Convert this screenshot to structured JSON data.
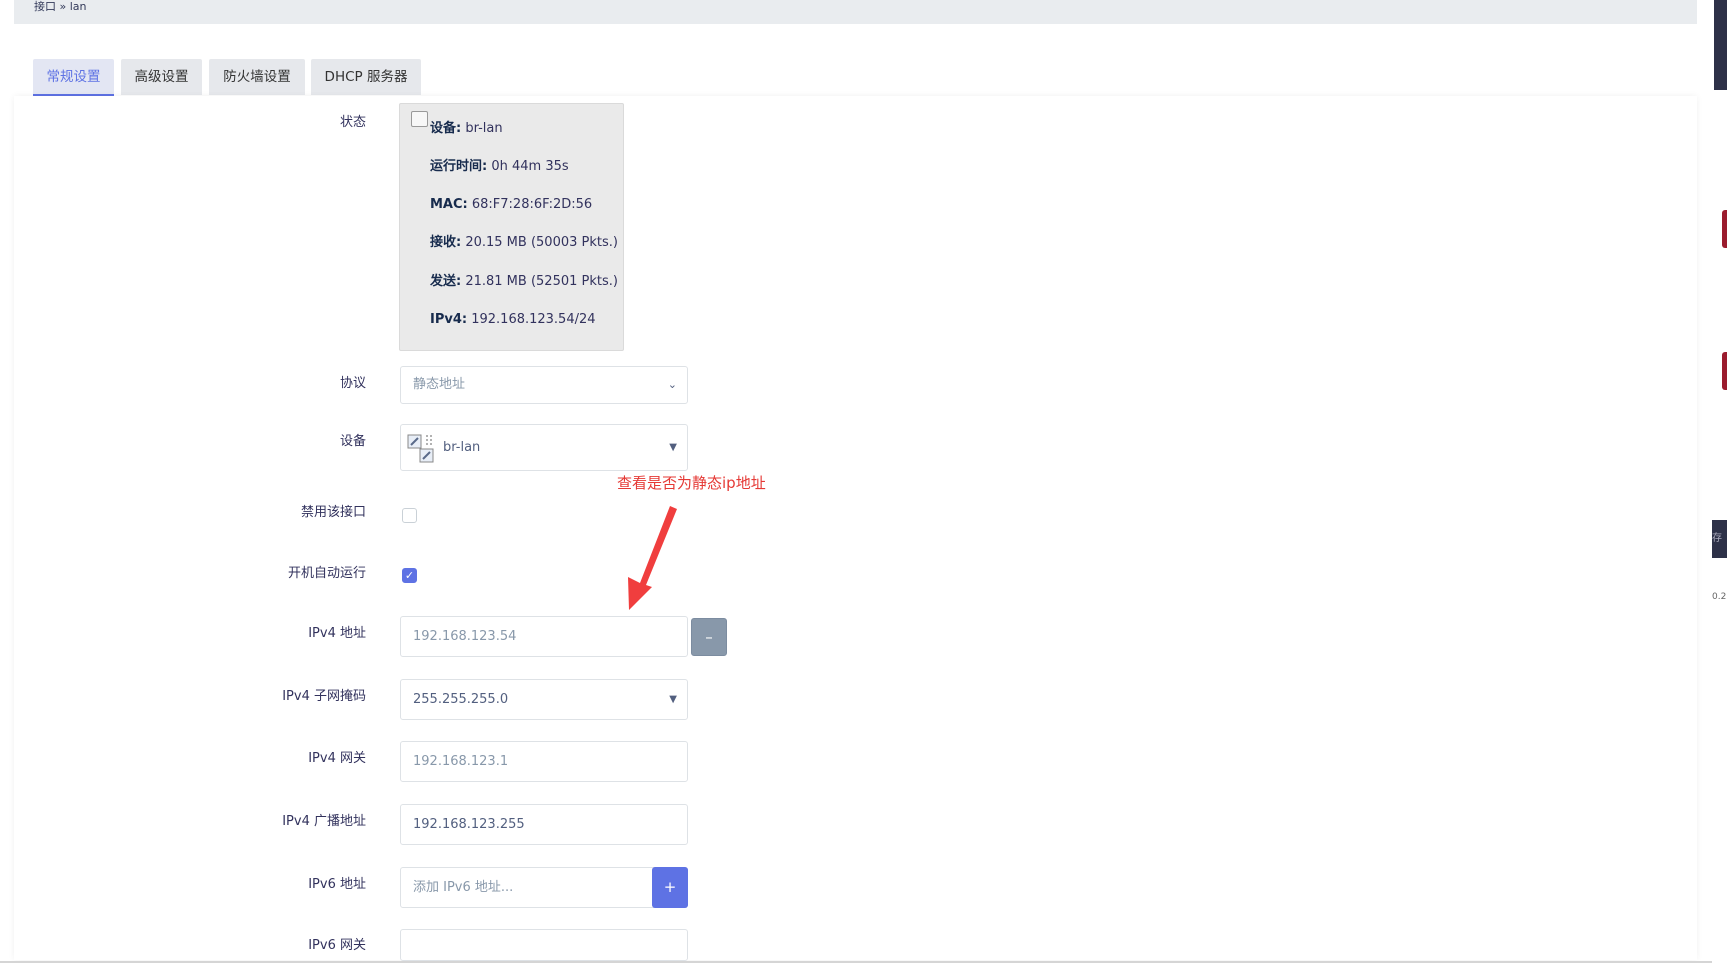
{
  "breadcrumb": "接口 » lan",
  "tabs": [
    {
      "label": "常规设置",
      "active": true
    },
    {
      "label": "高级设置"
    },
    {
      "label": "防火墙设置"
    },
    {
      "label": "DHCP 服务器"
    }
  ],
  "status": {
    "label": "状态",
    "lines": [
      {
        "key": "设备:",
        "value": " br-lan"
      },
      {
        "key": "运行时间:",
        "value": " 0h 44m 35s"
      },
      {
        "key": "MAC:",
        "value": " 68:F7:28:6F:2D:56"
      },
      {
        "key": "接收:",
        "value": " 20.15 MB (50003 Pkts.)"
      },
      {
        "key": "发送:",
        "value": " 21.81 MB (52501 Pkts.)"
      },
      {
        "key": "IPv4:",
        "value": " 192.168.123.54/24"
      }
    ]
  },
  "form": {
    "protocol": {
      "label": "协议",
      "value": "静态地址"
    },
    "device": {
      "label": "设备",
      "value": "br-lan"
    },
    "disable": {
      "label": "禁用该接口",
      "checked": false
    },
    "autostart": {
      "label": "开机自动运行",
      "checked": true
    },
    "ipv4_addr": {
      "label": "IPv4 地址",
      "value": "192.168.123.54",
      "remove_btn": "–"
    },
    "ipv4_mask": {
      "label": "IPv4 子网掩码",
      "value": "255.255.255.0"
    },
    "ipv4_gw": {
      "label": "IPv4 网关",
      "value": "192.168.123.1"
    },
    "ipv4_bcast": {
      "label": "IPv4 广播地址",
      "value": "192.168.123.255"
    },
    "ipv6_addr": {
      "label": "IPv6 地址",
      "placeholder": "添加 IPv6 地址...",
      "add_btn": "+"
    },
    "ipv6_gw": {
      "label": "IPv6 网关",
      "value": ""
    }
  },
  "annotation": "查看是否为静态ip地址",
  "colors": {
    "accent": "#5e72e4",
    "annotation": "#e53935",
    "remove_btn": "#8898aa"
  },
  "right_edge_text": {
    "save": "存",
    "ip_fragment": "0.2"
  }
}
